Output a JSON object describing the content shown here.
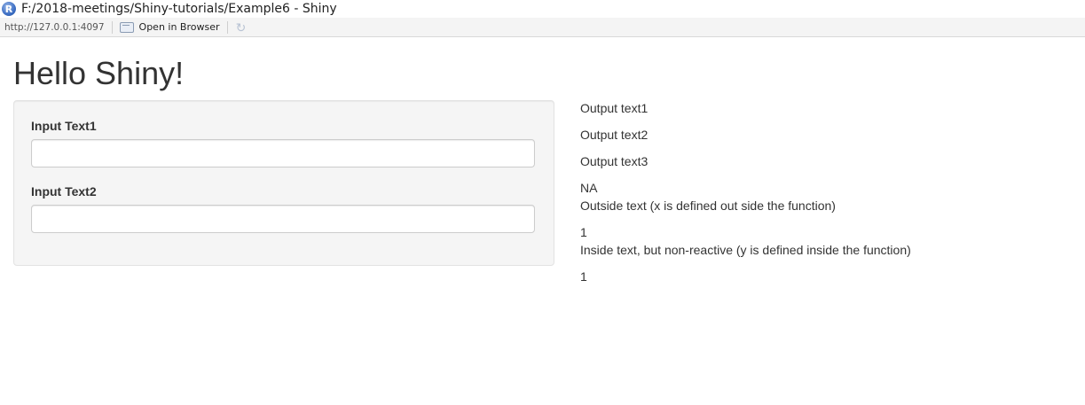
{
  "window": {
    "title": "F:/2018-meetings/Shiny-tutorials/Example6 - Shiny",
    "app_icon": "r-logo-icon",
    "app_icon_letter": "R"
  },
  "toolbar": {
    "url": "http://127.0.0.1:4097",
    "open_in_browser_label": "Open in Browser",
    "browser_icon": "browser-window-icon",
    "refresh_icon": "refresh-icon"
  },
  "page": {
    "title": "Hello Shiny!"
  },
  "sidebar": {
    "input1": {
      "label": "Input Text1",
      "value": "",
      "placeholder": ""
    },
    "input2": {
      "label": "Input Text2",
      "value": "",
      "placeholder": ""
    }
  },
  "main": {
    "output1": "Output text1",
    "output2": "Output text2",
    "output3": "Output text3",
    "value_x": "NA",
    "outside_text": "Outside text (x is defined out side the function)",
    "value_1": "1",
    "inside_text": "Inside text, but non-reactive (y is defined inside the function)",
    "value_2": "1"
  },
  "colors": {
    "panel_bg": "#f5f5f5",
    "panel_border": "#e3e3e3",
    "text": "#333333",
    "toolbar_bg": "#f4f4f4"
  }
}
